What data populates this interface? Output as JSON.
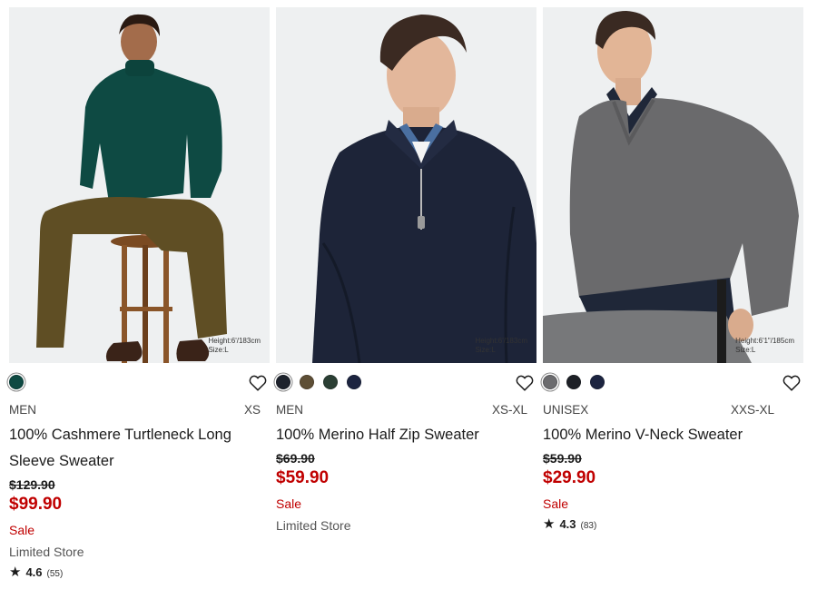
{
  "products": [
    {
      "swatches": [
        "#0e4a43"
      ],
      "height_note": [
        "Height:6'/183cm",
        "Size:L"
      ],
      "gender": "MEN",
      "sizes": "XS",
      "name": "100% Cashmere Turtleneck Long Sleeve Sweater",
      "original_price": "$129.90",
      "sale_price": "$99.90",
      "sale_label": "Sale",
      "store_note": "Limited Store",
      "rating": "4.6",
      "reviews": "(55)"
    },
    {
      "swatches": [
        "#1d222c",
        "#5e4f36",
        "#2b3f34",
        "#1c2440"
      ],
      "height_note": [
        "Height:6'/183cm",
        "Size:L"
      ],
      "gender": "MEN",
      "sizes": "XS-XL",
      "name": "100% Merino Half Zip Sweater",
      "original_price": "$69.90",
      "sale_price": "$59.90",
      "sale_label": "Sale",
      "store_note": "Limited Store"
    },
    {
      "swatches": [
        "#6b6b6e",
        "#1d2026",
        "#1c2440"
      ],
      "height_note": [
        "Height:6'1\"/185cm",
        "Size:L"
      ],
      "gender": "UNISEX",
      "sizes": "XXS-XL",
      "name": "100% Merino V-Neck Sweater",
      "original_price": "$59.90",
      "sale_price": "$29.90",
      "sale_label": "Sale",
      "rating": "4.3",
      "reviews": "(83)"
    }
  ],
  "colors": {
    "sale": "#c00000",
    "text": "#1b1b1b",
    "photo_bg": "#eef0f1"
  },
  "icons": {
    "favorite": "heart-outline-icon",
    "rating": "star-icon"
  }
}
